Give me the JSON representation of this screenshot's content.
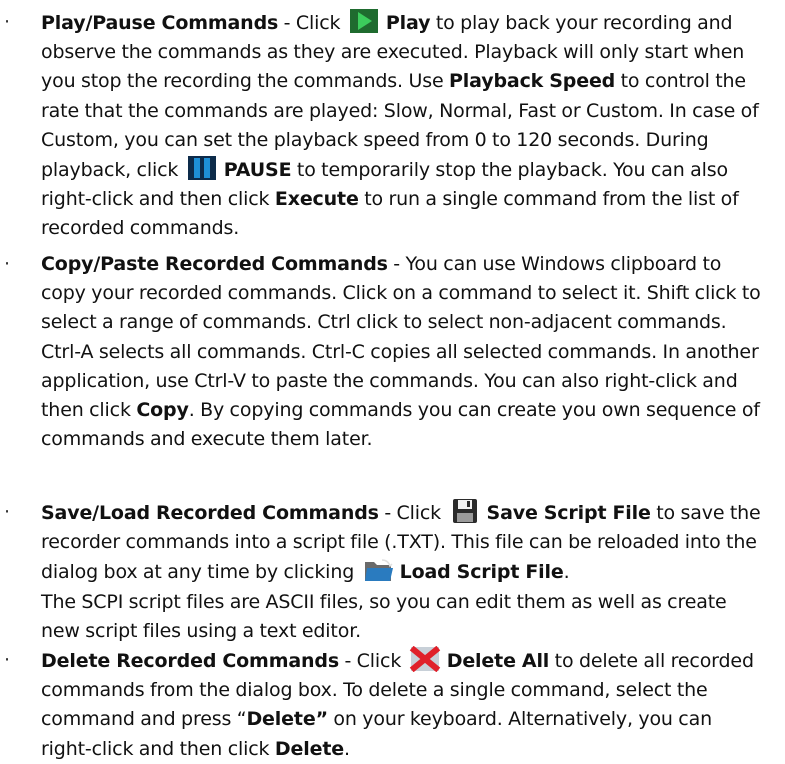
{
  "bullet_char": "·",
  "items": [
    {
      "title": "Play/Pause Commands",
      "t1": " - Click ",
      "play_label": "Play",
      "t2": " to play back your recording and observe the commands as they are executed. Playback will only start when you stop the recording the commands. Use ",
      "speed_label": "Playback Speed",
      "t3": " to control the rate that the commands are played: Slow, Normal, Fast or Custom. In case of Custom, you can set the playback speed from 0 to 120 seconds. During playback, click ",
      "pause_label": "PAUSE",
      "t4": " to temporarily stop the playback. You can also right-click and then click ",
      "execute_label": "Execute",
      "t5": " to run a single command from the list of recorded commands."
    },
    {
      "title": "Copy/Paste Recorded Commands",
      "t1": " - You can use Windows clipboard to copy your recorded commands. Click on a command to select it. Shift click to select a range of commands. Ctrl click to select non-adjacent commands. Ctrl-A selects all commands. Ctrl-C copies all selected commands. In another application, use Ctrl-V to paste the commands. You can also right-click and then click ",
      "copy_label": "Copy",
      "t2": ". By copying commands you can create you own sequence of commands and execute them later."
    },
    {
      "title": "Save/Load Recorded Commands",
      "t1": " - Click ",
      "save_label": "Save Script File",
      "t2": " to save the recorder commands into a script file (.TXT). This file can be reloaded into the dialog box at any time by clicking ",
      "load_label": "Load Script File",
      "t3": ".",
      "t4": "The SCPI script files are ASCII files, so you can edit them as well as create new script files using a text editor."
    },
    {
      "title": "Delete Recorded Commands",
      "t1": " - Click ",
      "delete_all_label": "Delete All",
      "t2": " to delete all recorded commands from the dialog box. To delete a single command, select the command and press “",
      "delete_key_label": "Delete”",
      "t3": " on your keyboard. Alternatively, you can right-click and then click ",
      "delete_label": "Delete",
      "t4": "."
    }
  ],
  "icons": {
    "play": "play-icon",
    "pause": "pause-icon",
    "save": "save-icon",
    "load": "open-folder-icon",
    "delete": "delete-x-icon"
  },
  "colors": {
    "play_green": "#2fa84f",
    "pause_blue": "#1e8fd6",
    "delete_red": "#e0202a",
    "folder_blue": "#2a7bbf"
  }
}
